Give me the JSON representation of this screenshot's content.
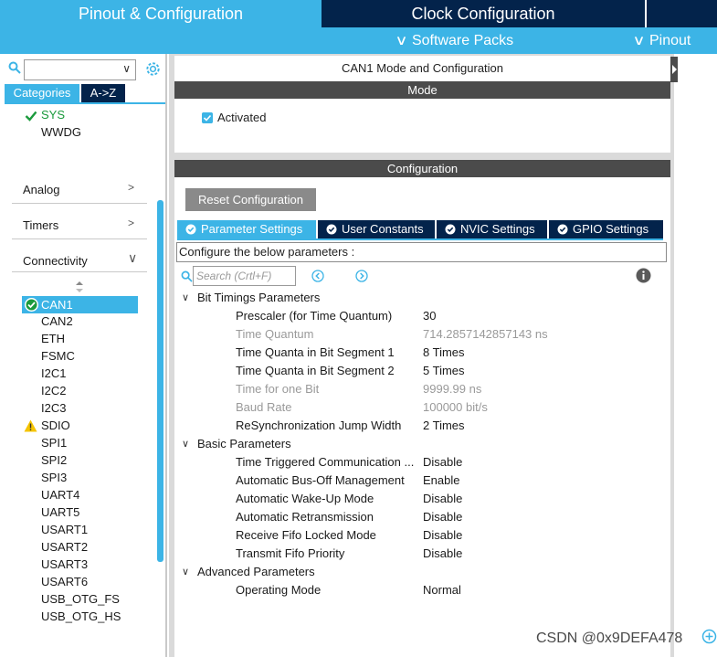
{
  "top_tabs": {
    "pinout": "Pinout & Configuration",
    "clock": "Clock Configuration"
  },
  "sub_bar": {
    "software_packs": "Software Packs",
    "pinout": "Pinout"
  },
  "left_panel": {
    "search_placeholder": "",
    "tabs": {
      "categories": "Categories",
      "az": "A->Z"
    },
    "system_items": [
      "SYS",
      "WWDG"
    ],
    "groups": [
      "Analog",
      "Timers",
      "Connectivity"
    ],
    "connectivity_items": [
      "CAN1",
      "CAN2",
      "ETH",
      "FSMC",
      "I2C1",
      "I2C2",
      "I2C3",
      "SDIO",
      "SPI1",
      "SPI2",
      "SPI3",
      "UART4",
      "UART5",
      "USART1",
      "USART2",
      "USART3",
      "USART6",
      "USB_OTG_FS",
      "USB_OTG_HS"
    ],
    "selected_item": "CAN1",
    "warning_item": "SDIO"
  },
  "mode_panel": {
    "title": "CAN1 Mode and Configuration",
    "header": "Mode",
    "activated_label": "Activated",
    "activated": true
  },
  "config_panel": {
    "header": "Configuration",
    "reset_label": "Reset Configuration",
    "tabs": [
      "Parameter Settings",
      "User Constants",
      "NVIC Settings",
      "GPIO Settings"
    ],
    "active_tab": "Parameter Settings",
    "configure_text": "Configure the below parameters :",
    "search_placeholder": "Search (Crtl+F)",
    "sections": [
      {
        "title": "Bit Timings Parameters",
        "params": [
          {
            "name": "Prescaler (for Time Quantum)",
            "value": "30",
            "dim": false
          },
          {
            "name": "Time Quantum",
            "value": "714.2857142857143 ns",
            "dim": true
          },
          {
            "name": "Time Quanta in Bit Segment 1",
            "value": "8 Times",
            "dim": false
          },
          {
            "name": "Time Quanta in Bit Segment 2",
            "value": "5 Times",
            "dim": false
          },
          {
            "name": "Time for one Bit",
            "value": "9999.99 ns",
            "dim": true
          },
          {
            "name": "Baud Rate",
            "value": "100000 bit/s",
            "dim": true
          },
          {
            "name": "ReSynchronization Jump Width",
            "value": "2 Times",
            "dim": false
          }
        ]
      },
      {
        "title": "Basic Parameters",
        "params": [
          {
            "name": "Time Triggered Communication ...",
            "value": "Disable",
            "dim": false
          },
          {
            "name": "Automatic Bus-Off Management",
            "value": "Enable",
            "dim": false
          },
          {
            "name": "Automatic Wake-Up Mode",
            "value": "Disable",
            "dim": false
          },
          {
            "name": "Automatic Retransmission",
            "value": "Disable",
            "dim": false
          },
          {
            "name": "Receive Fifo Locked Mode",
            "value": "Disable",
            "dim": false
          },
          {
            "name": "Transmit Fifo Priority",
            "value": "Disable",
            "dim": false
          }
        ]
      },
      {
        "title": "Advanced Parameters",
        "params": [
          {
            "name": "Operating Mode",
            "value": "Normal",
            "dim": false
          }
        ]
      }
    ]
  },
  "watermark": "CSDN @0x9DEFA478",
  "colors": {
    "accent": "#3cb4e6",
    "navy": "#03234b",
    "header_gray": "#4b4b4b",
    "ok_green": "#1a9a3c",
    "warning_yellow": "#f5c400"
  }
}
